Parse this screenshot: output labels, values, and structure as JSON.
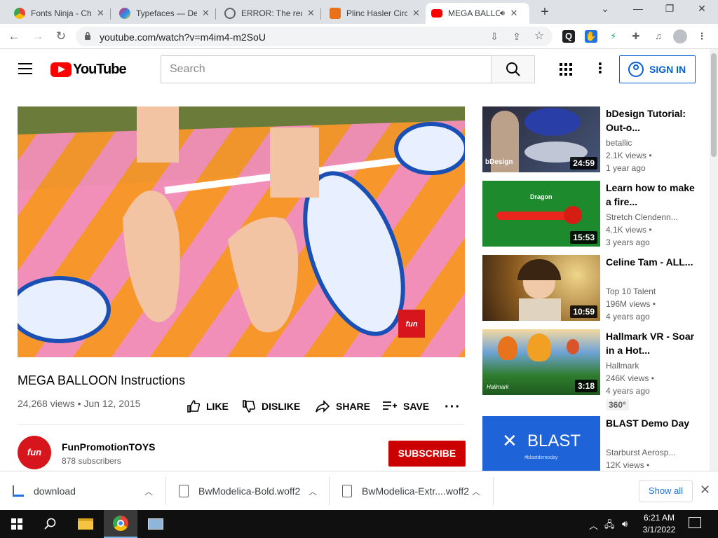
{
  "browser": {
    "tabs": [
      {
        "title": "Fonts Ninja - Ch",
        "favicon": "chrome-webstore-icon"
      },
      {
        "title": "Typefaces — De",
        "favicon": "typefaces-icon"
      },
      {
        "title": "ERROR: The requ",
        "favicon": "globe-icon"
      },
      {
        "title": "Plinc Hasler Circ",
        "favicon": "hasler-icon"
      },
      {
        "title": "MEGA BALLO",
        "favicon": "youtube-icon"
      }
    ],
    "url": "youtube.com/watch?v=m4im4-m2SoU"
  },
  "youtube": {
    "logo_text": "YouTube",
    "search_placeholder": "Search",
    "sign_in": "SIGN IN"
  },
  "video": {
    "title": "MEGA BALLOON Instructions",
    "meta": "24,268 views • Jun 12, 2015",
    "actions": {
      "like": "LIKE",
      "dislike": "DISLIKE",
      "share": "SHARE",
      "save": "SAVE"
    },
    "channel": {
      "avatar_text": "fun",
      "name": "FunPromotionTOYS",
      "subscribers": "878 subscribers"
    },
    "subscribe": "SUBSCRIBE",
    "overlay_logo": "fun"
  },
  "recommendations": [
    {
      "title": "bDesign Tutorial: Out-o...",
      "channel": "betallic",
      "views": "2.1K views •",
      "age": "1 year ago",
      "duration": "24:59",
      "thumb_text": "bDesign"
    },
    {
      "title": "Learn how to make a fire...",
      "channel": "Stretch Clendenn...",
      "views": "4.1K views •",
      "age": "3 years ago",
      "duration": "15:53",
      "thumb_text": "Dragon"
    },
    {
      "title": "Celine Tam - ALL...",
      "channel": "Top 10 Talent",
      "views": "196M views •",
      "age": "4 years ago",
      "duration": "10:59"
    },
    {
      "title": "Hallmark VR - Soar in a Hot...",
      "channel": "Hallmark",
      "views": "246K views •",
      "age": "4 years ago",
      "duration": "3:18",
      "badge": "360°",
      "thumb_text": "Hallmark"
    },
    {
      "title": "BLAST Demo Day",
      "channel": "Starburst Aerosp...",
      "views": "12K views •",
      "thumb_text": "BLAST",
      "thumb_sub": "#blastdemoday"
    }
  ],
  "downloads": {
    "items": [
      "download",
      "BwModelica-Bold.woff2",
      "BwModelica-Extr....woff2"
    ],
    "show_all": "Show all"
  },
  "taskbar": {
    "time": "6:21 AM",
    "date": "3/1/2022"
  }
}
